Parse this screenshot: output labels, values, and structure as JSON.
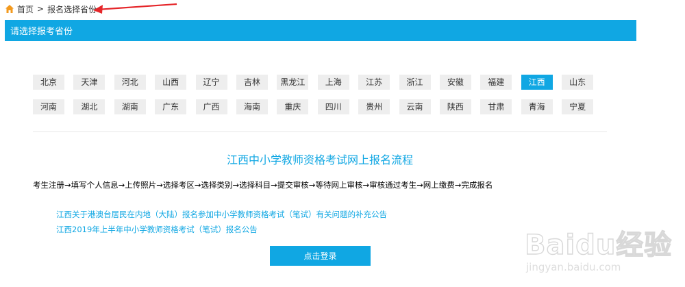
{
  "breadcrumb": {
    "home": "首页",
    "separator": ">",
    "current": "报名选择省份"
  },
  "banner": {
    "title": "请选择报考省份"
  },
  "provinces": {
    "row1": [
      "北京",
      "天津",
      "河北",
      "山西",
      "辽宁",
      "吉林",
      "黑龙江",
      "上海",
      "江苏",
      "浙江",
      "安徽",
      "福建",
      "江西",
      "山东"
    ],
    "row2": [
      "河南",
      "湖北",
      "湖南",
      "广东",
      "广西",
      "海南",
      "重庆",
      "四川",
      "贵州",
      "云南",
      "陕西",
      "甘肃",
      "青海",
      "宁夏"
    ],
    "selected": "江西"
  },
  "flow": {
    "title": "江西中小学教师资格考试网上报名流程",
    "steps": "考生注册→填写个人信息→上传照片→选择考区→选择类别→选择科目→提交审核→等待网上审核→审核通过考生→网上缴费→完成报名"
  },
  "notices": [
    "江西关于港澳台居民在内地（大陆）报名参加中小学教师资格考试（笔试）有关问题的补充公告",
    "江西2019年上半年中小学教师资格考试（笔试）报名公告"
  ],
  "login": {
    "label": "点击登录"
  },
  "watermark": {
    "logo": "Baidu经验",
    "url": "jingyan.baidu.com"
  },
  "colors": {
    "accent": "#10a7e3",
    "home_icon": "#f39a1e",
    "annotation_arrow": "#e5262a"
  }
}
